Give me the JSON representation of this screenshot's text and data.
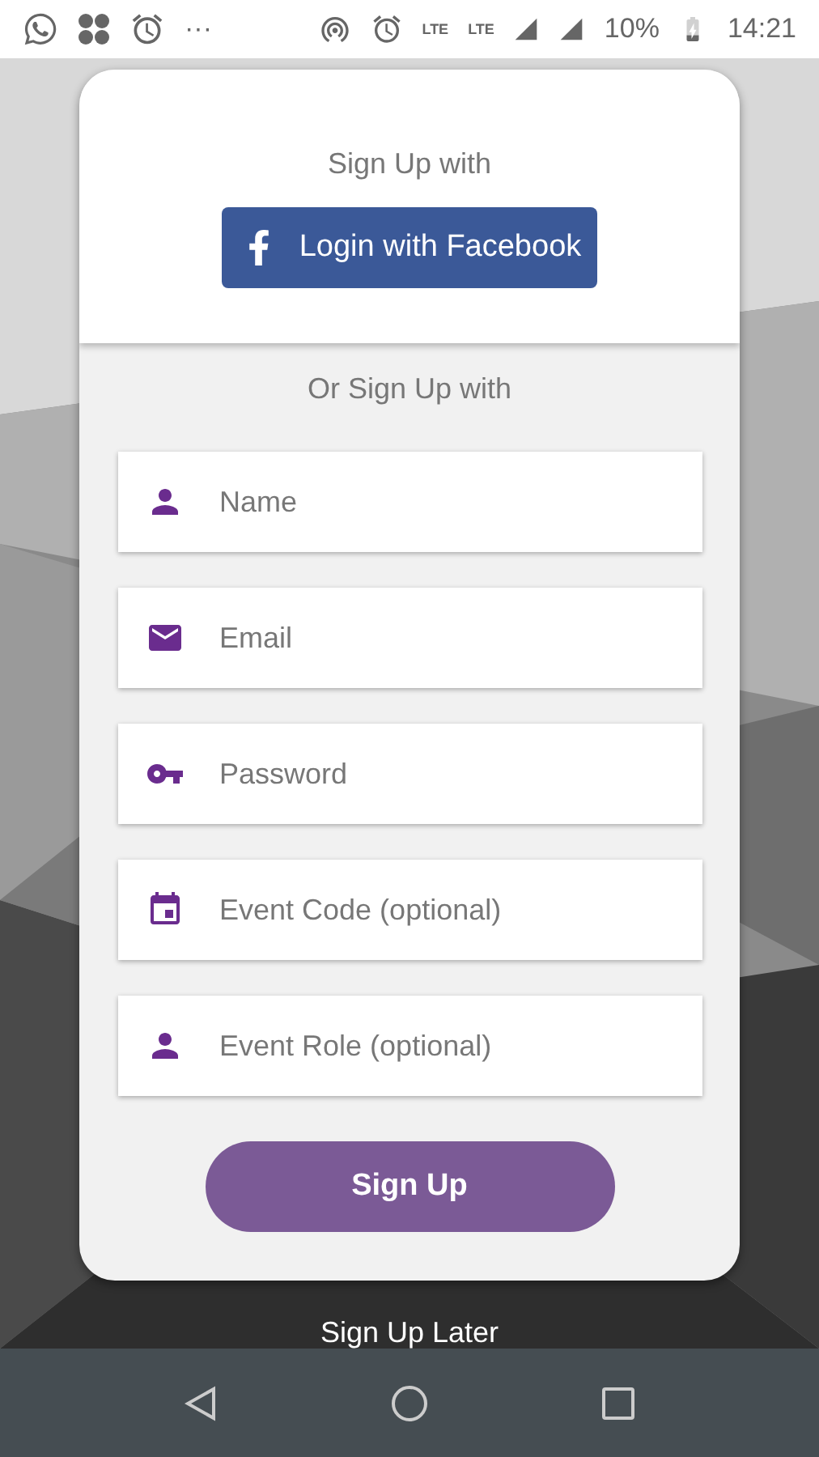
{
  "status_bar": {
    "overflow": "···",
    "network_left": "LTE",
    "network_right": "LTE",
    "battery": "10%",
    "time": "14:21"
  },
  "card": {
    "title": "Sign Up with",
    "facebook_button": "Login with Facebook",
    "alt_title": "Or Sign Up with",
    "fields": [
      {
        "kind": "person",
        "placeholder": "Name"
      },
      {
        "kind": "email",
        "placeholder": "Email"
      },
      {
        "kind": "key",
        "placeholder": "Password"
      },
      {
        "kind": "calendar",
        "placeholder": "Event Code (optional)"
      },
      {
        "kind": "person",
        "placeholder": "Event Role (optional)"
      }
    ],
    "submit_button": "Sign Up"
  },
  "skip_link": "Sign Up Later"
}
